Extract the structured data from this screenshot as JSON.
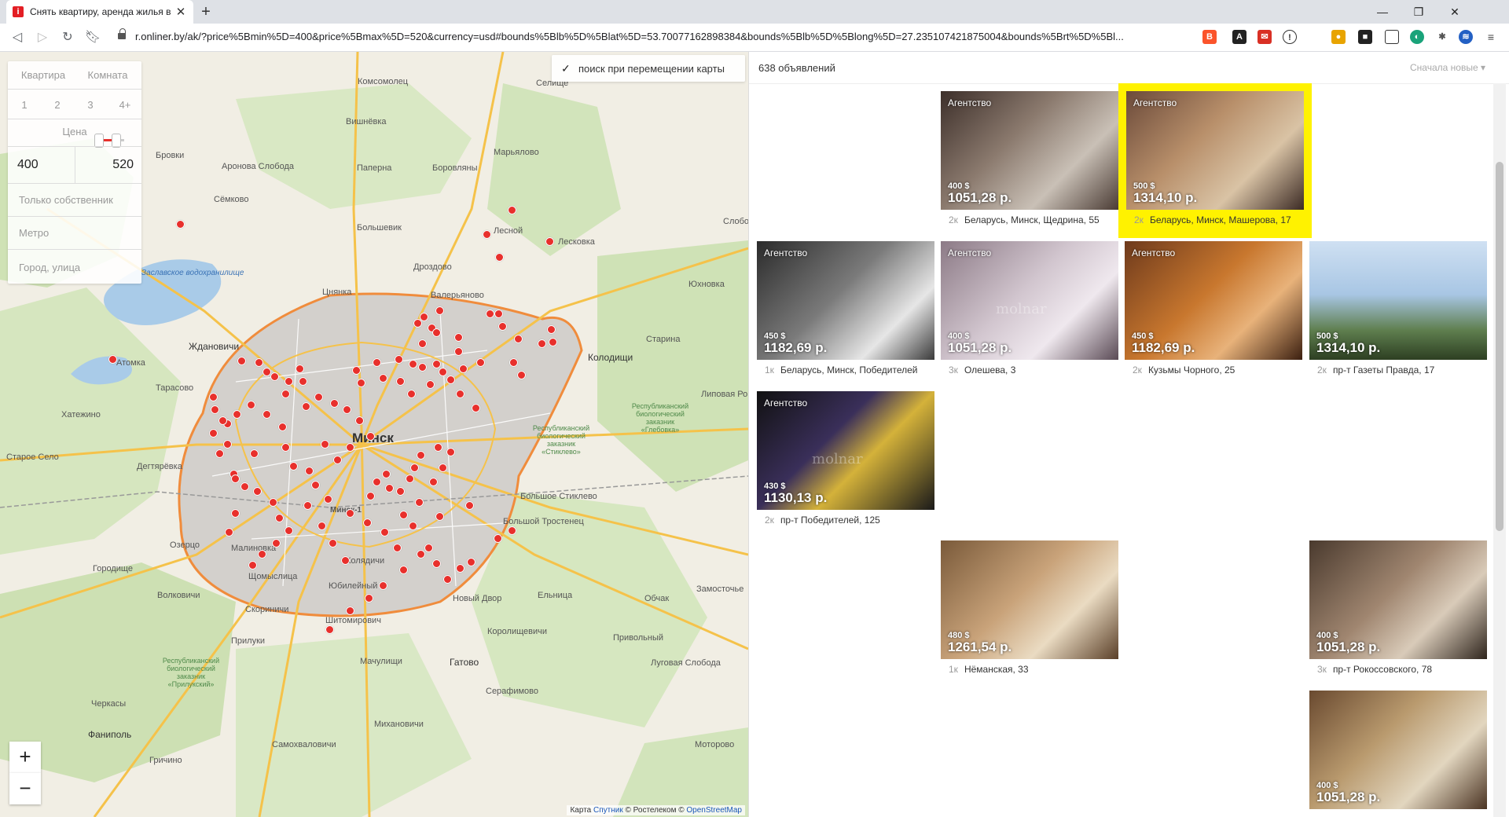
{
  "browser": {
    "tab_title": "Снять квартиру, аренда жилья в",
    "tab_favicon": "i",
    "url": "r.onliner.by/ak/?price%5Bmin%5D=400&price%5Bmax%5D=520&currency=usd#bounds%5Blb%5D%5Blat%5D=53.70077162898384&bounds%5Blb%5D%5Blong%5D=27.235107421875004&bounds%5Brt%5D%5Bl...",
    "icons": [
      "back-icon",
      "forward-icon",
      "reload-icon",
      "bookmark-icon",
      "lock-icon",
      "minimize-icon",
      "restore-icon",
      "close-icon"
    ]
  },
  "filters": {
    "type_options": [
      "Квартира",
      "Комната"
    ],
    "room_options": [
      "1",
      "2",
      "3",
      "4+"
    ],
    "price_label": "Цена",
    "price_min": "400",
    "price_max": "520",
    "owner_only": "Только собственник",
    "metro": "Метро",
    "city_street": "Город, улица"
  },
  "map": {
    "search_on_move": "поиск при перемещении карты",
    "zoom_in": "+",
    "zoom_out": "−",
    "attribution_prefix": "Карта",
    "attribution_sputnik": "Спутник",
    "attribution_mid": "© Ростелеком ©",
    "attribution_osm": "OpenStreetMap",
    "places": {
      "minsk": "Минск",
      "minsk1": "Минск-1",
      "komsomolets": "Комсомолец",
      "selishche": "Селище",
      "vishnevka": "Вишнёвка",
      "martsevo": "Марьялово",
      "brovki": "Бровки",
      "aronova": "Аронова Слобода",
      "paperna": "Папернa",
      "borovlyany": "Боровляны",
      "semkovo": "Сёмково",
      "bolshevik": "Большевик",
      "lesnoy": "Лесной",
      "leskovka": "Лесковка",
      "zaslavl": "Заславское водохранилище",
      "drozdovo": "Дроздово",
      "tsnyanka": "Цнянка",
      "valeryanovo": "Валерьяново",
      "yukhnovka": "Юхновка",
      "zhdanovichi": "Ждановичи",
      "atomka": "Атомка",
      "tarasovo": "Тарасово",
      "khatezhino": "Хатежино",
      "staroe_selo": "Старое Село",
      "degtyarevka": "Дегтярёвка",
      "ozertso": "Озерцо",
      "gorodishche": "Городище",
      "malinovka": "Малиновка",
      "shchomyslitsa": "Щомыслица",
      "volkovichi": "Волковичи",
      "skorinichi": "Скориничи",
      "shitomirovichi": "Шитомирович",
      "yubileyny": "Юбилейный",
      "kolyadichi": "Колядичи",
      "novy_dvor": "Новый Двор",
      "korolishchevichi": "Королищевичи",
      "eltnitsa": "Ельница",
      "obchak": "Обчак",
      "zamostochye": "Замосточье",
      "privolny": "Привольный",
      "lugovaya": "Луговая Слобода",
      "gatovo": "Гатово",
      "mochulishchi": "Мачулищи",
      "serafimovo": "Серафимово",
      "prilukhi": "Прилуки",
      "cherkasy": "Черкасы",
      "fanipol": "Фаниполь",
      "samokhvalovichi": "Самохваловичи",
      "michanovichi": "Михановичи",
      "grichino": "Гричино",
      "motorovo": "Моторово",
      "bolshoe_stiklevo": "Большое Стиклево",
      "bolshoy_trostenets": "Большой Тростенец",
      "kolodishchi": "Колодищи",
      "starina": "Старина",
      "lipovaya": "Липовая Роща",
      "slobo": "Слобо",
      "glebovka": "Республиканский биологический заказник «Глебовка»",
      "stiklevo": "Республиканский биологический заказник «Стиклево»",
      "prilukskiy": "Республиканский биологический заказник «Прилукский»"
    }
  },
  "results": {
    "count": "638 объявлений",
    "sort": "Сначала новые",
    "listings": [
      {
        "badge": "Агентство",
        "usd": "400 $",
        "byn": "1051,28 р.",
        "rooms": "2к",
        "address": "Беларусь, Минск, Щедрина, 55"
      },
      {
        "badge": "Агентство",
        "usd": "500 $",
        "byn": "1314,10 р.",
        "rooms": "2к",
        "address": "Беларусь, Минск, Машерова, 17",
        "highlighted": true
      },
      {
        "badge": "Агентство",
        "usd": "450 $",
        "byn": "1182,69 р.",
        "rooms": "1к",
        "address": "Беларусь, Минск, Победителей"
      },
      {
        "badge": "Агентство",
        "usd": "400 $",
        "byn": "1051,28 р.",
        "rooms": "3к",
        "address": "Олешева, 3"
      },
      {
        "badge": "Агентство",
        "usd": "450 $",
        "byn": "1182,69 р.",
        "rooms": "2к",
        "address": "Кузьмы Чорного, 25"
      },
      {
        "badge": "",
        "usd": "500 $",
        "byn": "1314,10 р.",
        "rooms": "2к",
        "address": "пр-т Газеты Правда, 17"
      },
      {
        "badge": "Агентство",
        "usd": "430 $",
        "byn": "1130,13 р.",
        "rooms": "2к",
        "address": "пр-т Победителей, 125"
      },
      {
        "badge": "",
        "usd": "480 $",
        "byn": "1261,54 р.",
        "rooms": "1к",
        "address": "Нёманская, 33"
      },
      {
        "badge": "",
        "usd": "400 $",
        "byn": "1051,28 р.",
        "rooms": "3к",
        "address": "пр-т Рокоссовского, 78"
      },
      {
        "badge": "",
        "usd": "400 $",
        "byn": "1051,28 р.",
        "rooms": "",
        "address": ""
      }
    ],
    "watermark": "molnar"
  },
  "colors": {
    "accent": "#e8302c",
    "highlight": "#fff200",
    "map_bg": "#f1eee4"
  }
}
